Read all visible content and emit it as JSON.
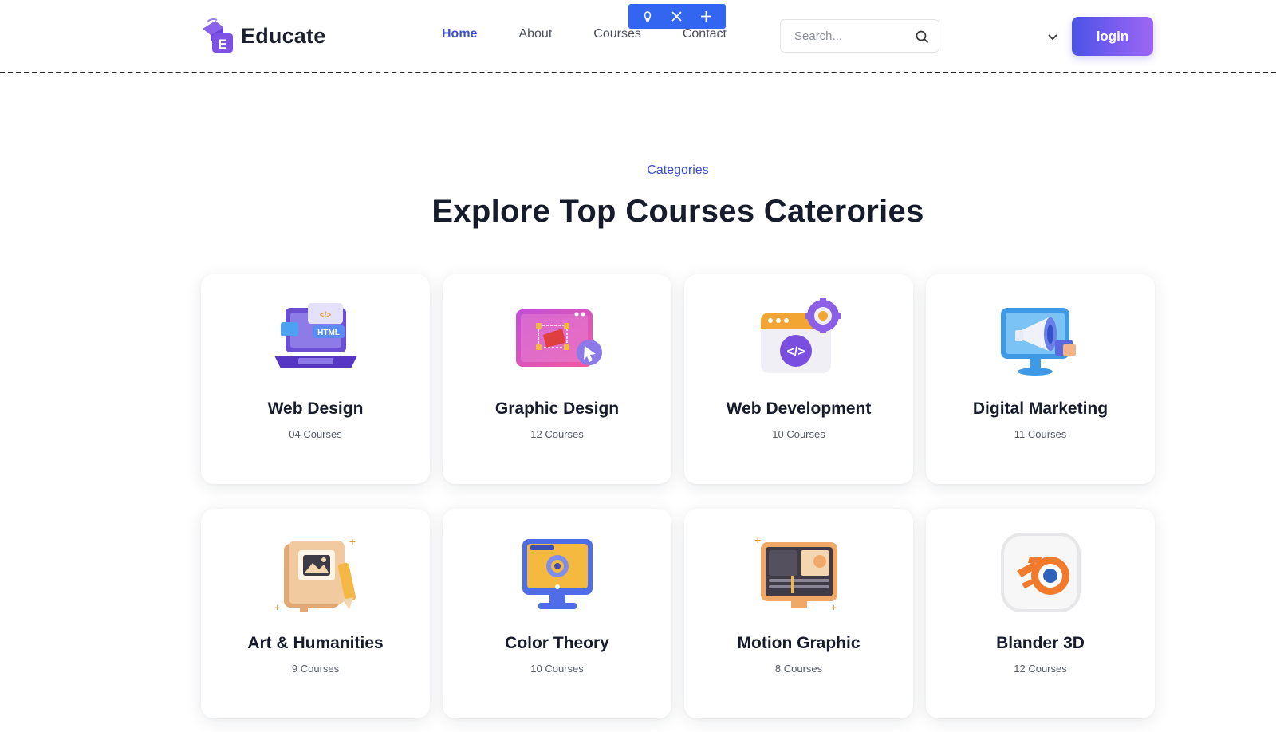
{
  "brand": {
    "name": "Educate",
    "logo_letter": "E",
    "accent": "#6c4bd9"
  },
  "nav": {
    "items": [
      {
        "label": "Home",
        "active": true
      },
      {
        "label": "About",
        "active": false
      },
      {
        "label": "Courses",
        "active": false
      },
      {
        "label": "Contact",
        "active": false
      }
    ]
  },
  "editor_toolbar": {
    "icons": [
      "drag-handle-icon",
      "close-icon",
      "plus-icon"
    ],
    "color": "#3366f0"
  },
  "search": {
    "placeholder": "Search...",
    "value": "",
    "icon": "search-icon"
  },
  "header_right": {
    "dropdown_icon": "chevron-down-icon",
    "login_label": "login"
  },
  "section": {
    "tag": "Categories",
    "title": "Explore Top Courses Caterories",
    "tag_color": "#3a4fd1"
  },
  "categories": [
    {
      "title": "Web Design",
      "count": "04 Courses",
      "icon": "laptop-html-icon"
    },
    {
      "title": "Graphic Design",
      "count": "12 Courses",
      "icon": "design-canvas-icon"
    },
    {
      "title": "Web Development",
      "count": "10 Courses",
      "icon": "code-gear-icon"
    },
    {
      "title": "Digital Marketing",
      "count": "11 Courses",
      "icon": "megaphone-monitor-icon"
    },
    {
      "title": "Art & Humanities",
      "count": "9 Courses",
      "icon": "art-book-icon"
    },
    {
      "title": "Color Theory",
      "count": "10 Courses",
      "icon": "color-monitor-icon"
    },
    {
      "title": "Motion Graphic",
      "count": "8 Courses",
      "icon": "video-editor-icon"
    },
    {
      "title": "Blander 3D",
      "count": "12 Courses",
      "icon": "blender-logo-icon"
    }
  ]
}
